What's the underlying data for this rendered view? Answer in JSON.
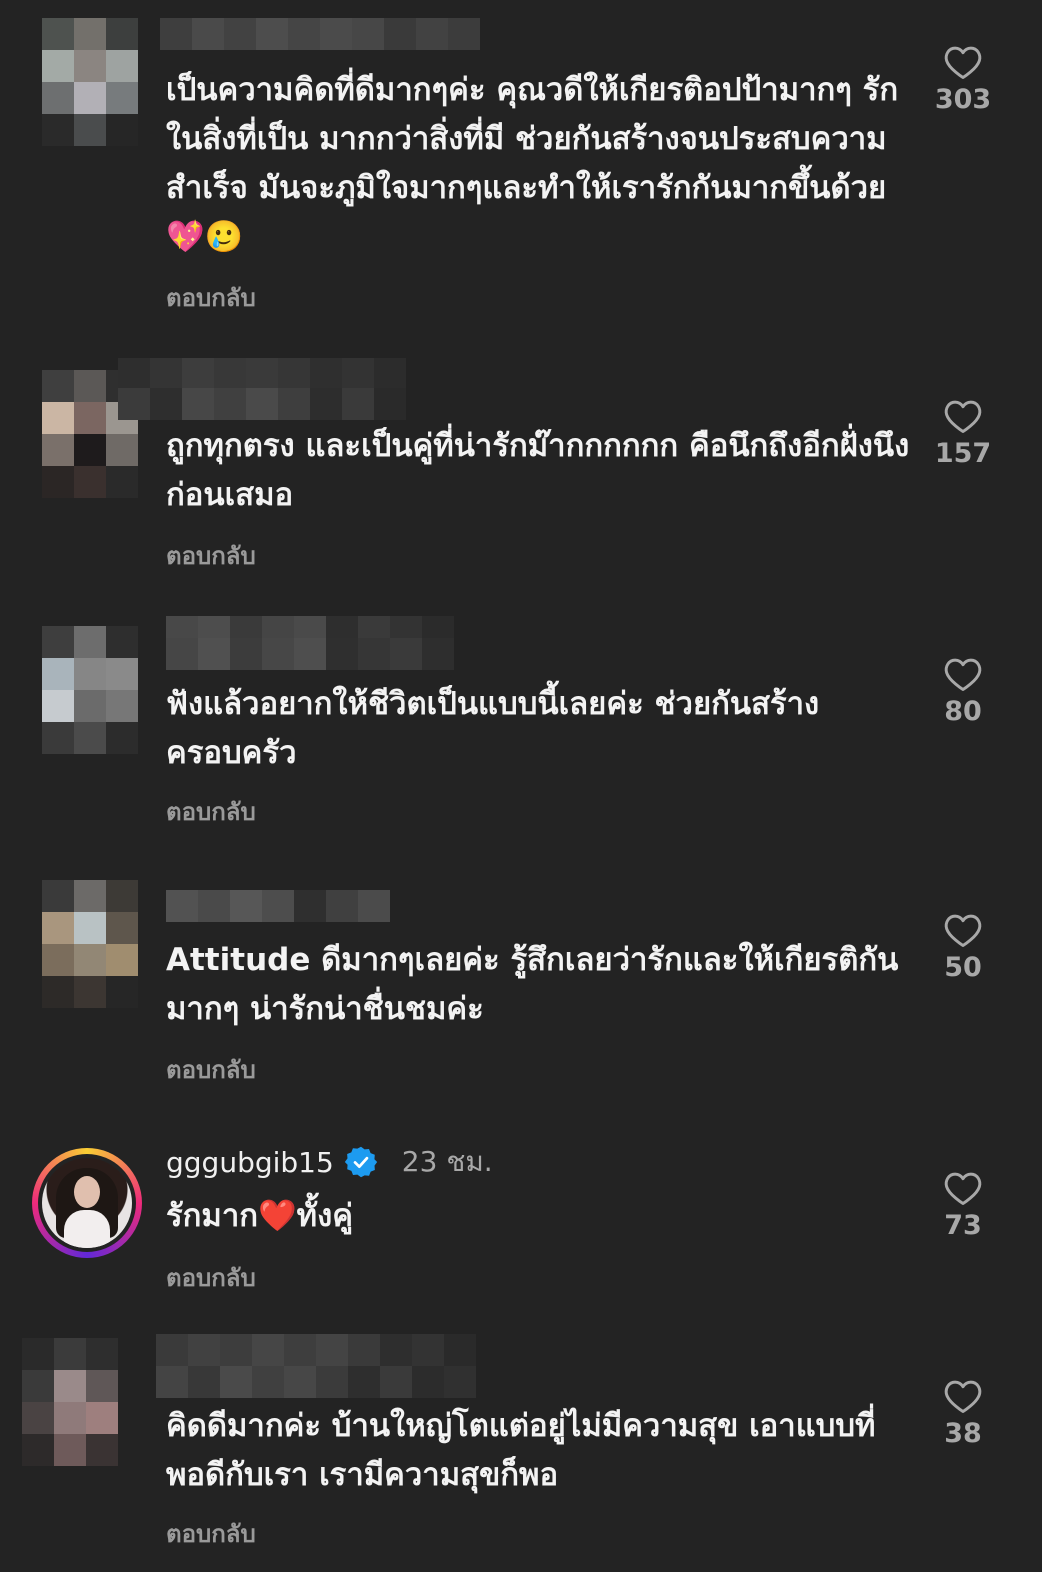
{
  "comments": [
    {
      "text": "เป็นความคิดที่ดีมากๆค่ะ คุณวดีให้เกียรติอปป้ามากๆ รักในสิ่งที่เป็น มากกว่าสิ่งที่มี ช่วยกันสร้างจนประสบความสำเร็จ มันจะภูมิใจมากๆและทำให้เรารักกันมากขึ้นด้วย 💖🥲",
      "reply": "ตอบกลับ",
      "likes": "303"
    },
    {
      "text": "ถูกทุกตรง และเป็นคู่ที่น่ารักม๊ากกกกกก คือนึกถึงอีกฝั่งนึงก่อนเสมอ",
      "reply": "ตอบกลับ",
      "likes": "157"
    },
    {
      "text": "ฟังแล้วอยากให้ชีวิตเป็นแบบนี้เลยค่ะ ช่วยกันสร้างครอบครัว",
      "reply": "ตอบกลับ",
      "likes": "80"
    },
    {
      "text": "Attitude ดีมากๆเลยค่ะ รู้สึกเลยว่ารักและให้เกียรติกันมากๆ น่ารักน่าชื่นชมค่ะ",
      "reply": "ตอบกลับ",
      "likes": "50"
    },
    {
      "username": "gggubgib15",
      "time": "23 ชม.",
      "text": "รักมาก❤️ทั้งคู่",
      "reply": "ตอบกลับ",
      "likes": "73"
    },
    {
      "text": "คิดดีมากค่ะ บ้านใหญ่โตแต่อยู่ไม่มีความสุข เอาแบบที่พอดีกับเรา เรามีความสุขก็พอ",
      "reply": "ตอบกลับ",
      "likes": "38"
    }
  ],
  "colors": {
    "background": "#232323",
    "verified": "#1d9bf0",
    "muted": "#a8a8a8"
  },
  "icons": {
    "like": "heart-outline-icon",
    "verified": "verified-badge-icon"
  }
}
